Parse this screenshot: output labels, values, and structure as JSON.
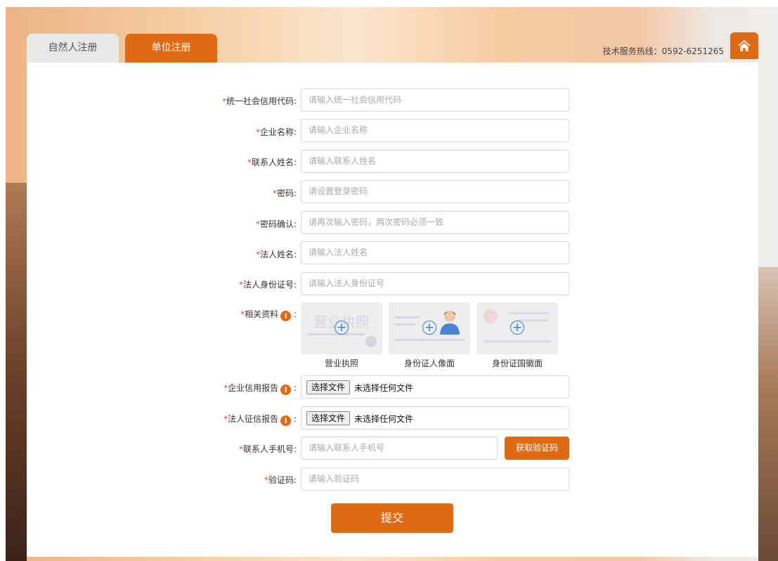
{
  "tabs": [
    {
      "label": "自然人注册",
      "active": false
    },
    {
      "label": "单位注册",
      "active": true
    }
  ],
  "header": {
    "hotline": "技术服务热线：0592-6251265",
    "home_icon": "home-icon"
  },
  "form": {
    "fields": [
      {
        "required": "*",
        "label": "统一社会信用代码:",
        "placeholder": "请输入统一社会信用代码"
      },
      {
        "required": "*",
        "label": "企业名称:",
        "placeholder": "请输入企业名称"
      },
      {
        "required": "*",
        "label": "联系人姓名:",
        "placeholder": "请输入联系人姓名"
      },
      {
        "required": "*",
        "label": "密码:",
        "placeholder": "请设置登录密码"
      },
      {
        "required": "*",
        "label": "密码确认:",
        "placeholder": "请再次输入密码，两次密码必须一致"
      },
      {
        "required": "*",
        "label": "法人姓名:",
        "placeholder": "请输入法人姓名"
      },
      {
        "required": "*",
        "label": "法人身份证号:",
        "placeholder": "请输入法人身份证号"
      }
    ],
    "materials": {
      "required": "*",
      "label": "相关资料",
      "colon": ":",
      "uploads": [
        {
          "caption": "营业执照",
          "ghost": "营业执照"
        },
        {
          "caption": "身份证人像面",
          "ghost": ""
        },
        {
          "caption": "身份证国徽面",
          "ghost": ""
        }
      ]
    },
    "credit_report": {
      "required": "*",
      "label": "企业信用报告",
      "colon": ":",
      "button": "选择文件",
      "status": "未选择任何文件"
    },
    "legal_report": {
      "required": "*",
      "label": "法人征信报告",
      "colon": ":",
      "button": "选择文件",
      "status": "未选择任何文件"
    },
    "phone": {
      "required": "*",
      "label": "联系人手机号:",
      "placeholder": "请输入联系人手机号",
      "code_button": "获取验证码"
    },
    "captcha": {
      "required": "*",
      "label": "验证码:",
      "placeholder": "请输入验证码"
    },
    "submit": "提交"
  },
  "colors": {
    "accent": "#df6a13",
    "required": "#e0502b",
    "upload_plus": "#3a7fd6"
  }
}
